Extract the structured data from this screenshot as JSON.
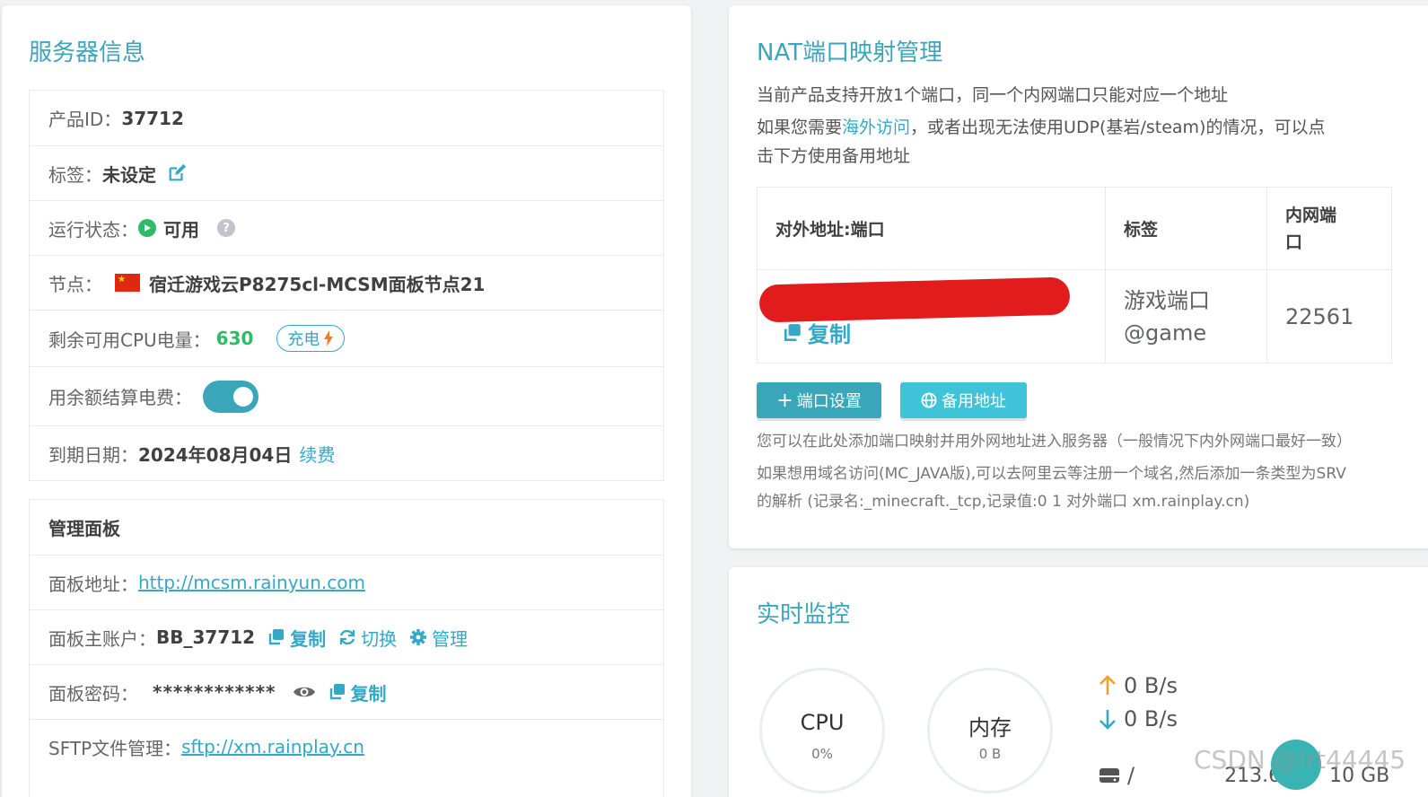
{
  "server_info": {
    "title": "服务器信息",
    "product_id_label": "产品ID：",
    "product_id": "37712",
    "tag_label": "标签：",
    "tag_value": "未设定",
    "status_label": "运行状态：",
    "status_value": "可用",
    "node_label": "节点：",
    "node_value": "宿迁游戏云P8275cl-MCSM面板节点21",
    "cpu_power_label": "剩余可用CPU电量：",
    "cpu_power_value": "630",
    "charge_label": "充电",
    "balance_label": "用余额结算电费：",
    "expire_label": "到期日期：",
    "expire_value": "2024年08月04日",
    "renew_label": "续费"
  },
  "panel": {
    "title": "管理面板",
    "address_label": "面板地址：",
    "address_value": "http://mcsm.rainyun.com",
    "account_label": "面板主账户：",
    "account_value": "BB_37712",
    "copy_label": "复制",
    "switch_label": "切换",
    "manage_label": "管理",
    "password_label": "面板密码：",
    "password_value": "************",
    "sftp_label": "SFTP文件管理：",
    "sftp_value": "sftp://xm.rainplay.cn"
  },
  "nat": {
    "title": "NAT端口映射管理",
    "line1": "当前产品支持开放1个端口，同一个内网端口只能对应一个地址",
    "line2_pre": "如果您需要",
    "line2_link": "海外访问",
    "line2_post": "，或者出现无法使用UDP(基岩/steam)的情况，可以点",
    "line3": "击下方使用备用地址",
    "col_addr": "对外地址:端口",
    "col_tag": "标签",
    "col_inner_1": "内网端",
    "col_inner_2": "口",
    "row_copy": "复制",
    "row_tag_1": "游戏端口",
    "row_tag_2": "@game",
    "row_inner": "22561",
    "btn_port": "端口设置",
    "btn_backup": "备用地址",
    "note1": "您可以在此处添加端口映射并用外网地址进入服务器（一般情况下内外网端口最好一致）",
    "note2": "如果想用域名访问(MC_JAVA版),可以去阿里云等注册一个域名,然后添加一条类型为SRV",
    "note3": "的解析 (记录名:_minecraft._tcp,记录值:0 1 对外端口 xm.rainplay.cn)"
  },
  "monitor": {
    "title": "实时监控",
    "cpu_label": "CPU",
    "cpu_value": "0%",
    "mem_label": "内存",
    "mem_value": "0 B",
    "up_speed": "0 B/s",
    "down_speed": "0 B/s",
    "disk_sep": "/",
    "disk_used": "213.6",
    "disk_total": "10 GB"
  },
  "watermark": "CSDN @lrt44445",
  "colors": {
    "accent": "#35a8c8",
    "title": "#3aa6bd",
    "ok": "#2dbb66",
    "redaction": "#e21c1c"
  }
}
